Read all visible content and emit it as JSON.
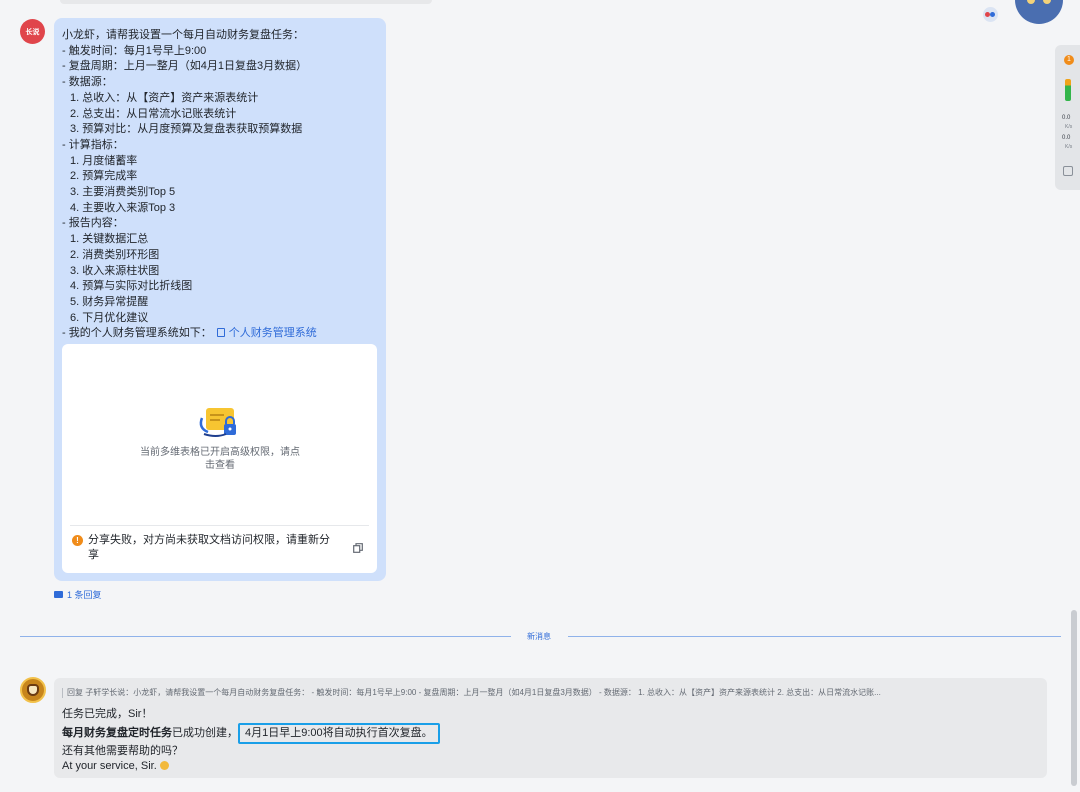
{
  "user": {
    "avatar_text": "长说"
  },
  "user_message": {
    "lines": [
      "小龙虾，请帮我设置一个每月自动财务复盘任务：",
      "- 触发时间：每月1号早上9:00",
      "- 复盘周期：上月一整月（如4月1日复盘3月数据）",
      "- 数据源：",
      "1. 总收入：从【资产】资产来源表统计",
      "2. 总支出：从日常流水记账表统计",
      "3. 预算对比：从月度预算及复盘表获取预算数据",
      "- 计算指标：",
      "1. 月度储蓄率",
      "2. 预算完成率",
      "3. 主要消费类别Top 5",
      "4. 主要收入来源Top 3",
      "- 报告内容：",
      "1. 关键数据汇总",
      "2. 消费类别环形图",
      "3. 收入来源柱状图",
      "4. 预算与实际对比折线图",
      "5. 财务异常提醒",
      "6. 下月优化建议"
    ],
    "system_prefix": "- 我的个人财务管理系统如下：",
    "system_link": "个人财务管理系统",
    "card_text": "当前多维表格已开启高级权限，请点击查看",
    "share_warning": "分享失败，对方尚未获取文档访问权限，请重新分享",
    "reply_count": "1 条回复"
  },
  "divider": {
    "label": "新消息"
  },
  "bot_message": {
    "quote": "回复 子轩学长说：小龙虾，请帮我设置一个每月自动财务复盘任务： - 触发时间：每月1号早上9:00 - 复盘周期：上月一整月（如4月1日复盘3月数据） - 数据源： 1. 总收入：从【资产】资产来源表统计 2. 总支出：从日常流水记账...",
    "line1": "任务已完成，Sir！",
    "task_name": "每月财务复盘定时任务",
    "created": "已成功创建，",
    "highlight": "4月1日早上9:00将自动执行首次复盘。",
    "line3": "还有其他需要帮助的吗？",
    "line4": "At your service, Sir."
  },
  "rail": {
    "badge": "1",
    "up_value": "0.0",
    "up_unit": "K/s",
    "down_value": "0.0",
    "down_unit": "K/s"
  },
  "colors": {
    "bubble_bg": "#cfe0fb",
    "link": "#2f6bd8",
    "highlight_border": "#1a9fe8",
    "warning": "#f08c1a"
  },
  "icons": [
    "table-lock-icon",
    "warning-icon",
    "copy-icon",
    "reply-icon",
    "doc-icon",
    "emoji-icon"
  ]
}
